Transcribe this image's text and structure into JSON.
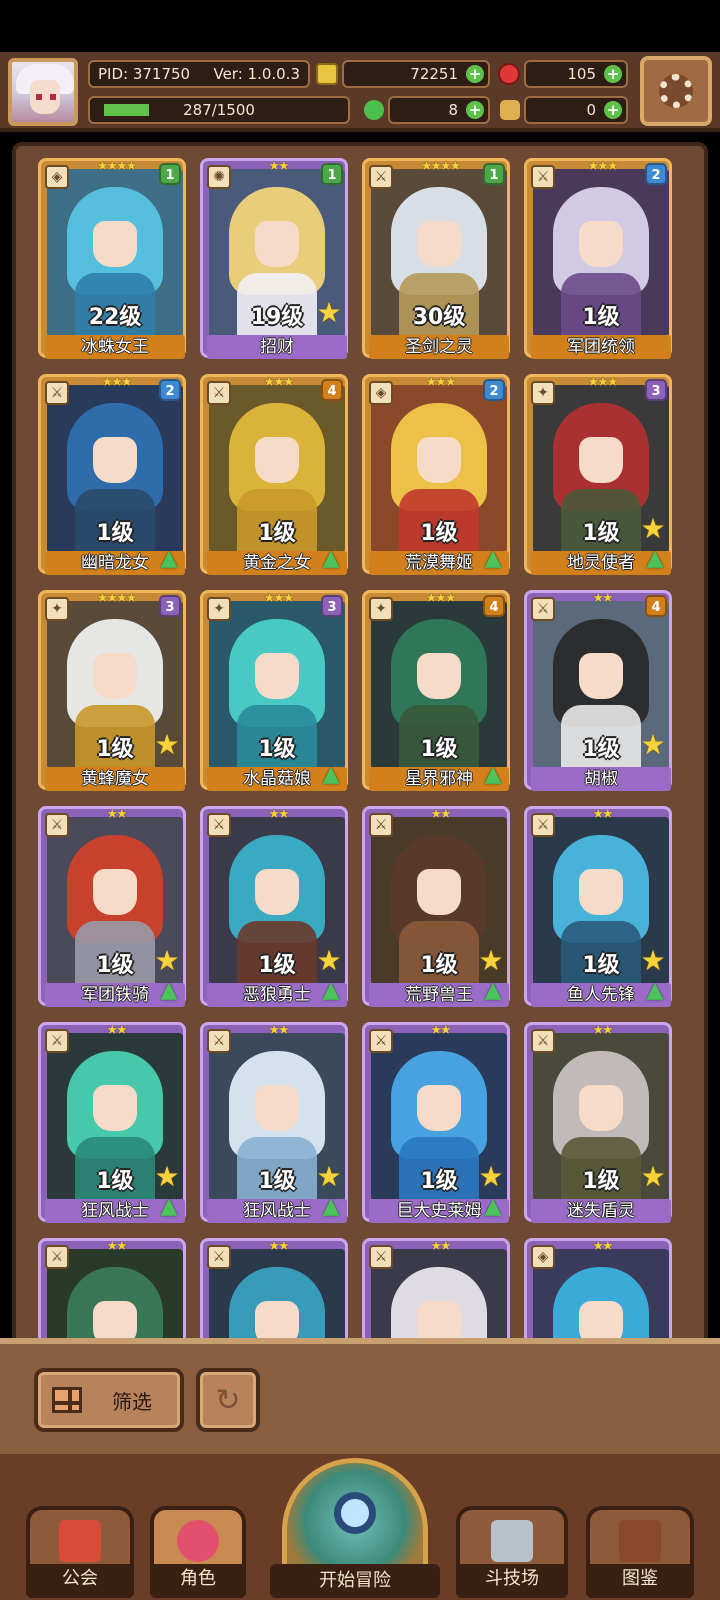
{
  "header": {
    "pid": "PID: 371750",
    "version": "Ver: 1.0.0.3",
    "gold": "72251",
    "gems": "105",
    "exp_text": "287/1500",
    "exp_progress": 0.19,
    "clover": "8",
    "hand": "0",
    "icons": [
      "avatar",
      "coin-icon",
      "ruby-icon",
      "leaf-icon",
      "clover-icon",
      "hand-icon",
      "gear-icon"
    ]
  },
  "cards": [
    {
      "name": "冰蛛女王",
      "level": "22级",
      "stars": "★★★★",
      "badge": "1",
      "frame": "orange",
      "role": "shield",
      "hair": "#59c3e3",
      "body": "#2f7ea8",
      "bg": "#3f6f86",
      "star": false,
      "up": false
    },
    {
      "name": "招财",
      "level": "19级",
      "stars": "★★",
      "badge": "1",
      "frame": "purple",
      "role": "sun",
      "hair": "#f0d47a",
      "body": "#f3f0f5",
      "bg": "#4a5a7a",
      "star": true,
      "up": false
    },
    {
      "name": "圣剑之灵",
      "level": "30级",
      "stars": "★★★★",
      "badge": "1",
      "frame": "orange",
      "role": "sword",
      "hair": "#dfe6ef",
      "body": "#b59a5a",
      "bg": "#5a4a3a",
      "star": false,
      "up": false
    },
    {
      "name": "军团统领",
      "level": "1级",
      "stars": "★★★",
      "badge": "2",
      "frame": "orange",
      "role": "sword",
      "hair": "#d8d2ea",
      "body": "#6a4a8a",
      "bg": "#4a3a5a",
      "star": false,
      "up": false
    },
    {
      "name": "幽暗龙女",
      "level": "1级",
      "stars": "★★★",
      "badge": "2",
      "frame": "orange",
      "role": "sword",
      "hair": "#2f6fb0",
      "body": "#2a4a6a",
      "bg": "#2a3a5a",
      "star": false,
      "up": true
    },
    {
      "name": "黄金之女",
      "level": "1级",
      "stars": "★★★",
      "badge": "4",
      "frame": "orange",
      "role": "sword",
      "hair": "#e0b83a",
      "body": "#c9982a",
      "bg": "#6a5a2a",
      "star": false,
      "up": true
    },
    {
      "name": "荒漠舞姬",
      "level": "1级",
      "stars": "★★★",
      "badge": "2",
      "frame": "orange",
      "role": "shield",
      "hair": "#f2c64a",
      "body": "#c0392b",
      "bg": "#8a4a2a",
      "star": false,
      "up": true
    },
    {
      "name": "地灵使者",
      "level": "1级",
      "stars": "★★★",
      "badge": "3",
      "frame": "orange",
      "role": "staff",
      "hair": "#b03030",
      "body": "#4a5a3a",
      "bg": "#3a3a3a",
      "star": true,
      "up": true
    },
    {
      "name": "黄蜂魔女",
      "level": "1级",
      "stars": "★★★★",
      "badge": "3",
      "frame": "orange",
      "role": "staff",
      "hair": "#eeeeee",
      "body": "#c9982a",
      "bg": "#5a4a3a",
      "star": true,
      "up": false
    },
    {
      "name": "水晶菇娘",
      "level": "1级",
      "stars": "★★★",
      "badge": "3",
      "frame": "orange",
      "role": "staff",
      "hair": "#4ad0c8",
      "body": "#2a8a9a",
      "bg": "#2a5a6a",
      "star": false,
      "up": true
    },
    {
      "name": "星界邪神",
      "level": "1级",
      "stars": "★★★",
      "badge": "4",
      "frame": "orange",
      "role": "staff",
      "hair": "#2f7a5a",
      "body": "#3a5a3a",
      "bg": "#2a3a3a",
      "star": false,
      "up": true
    },
    {
      "name": "胡椒",
      "level": "1级",
      "stars": "★★",
      "badge": "4",
      "frame": "purple",
      "role": "sword",
      "hair": "#2a2a2a",
      "body": "#e8e8e8",
      "bg": "#5a6a7a",
      "star": true,
      "up": false
    },
    {
      "name": "军团铁骑",
      "level": "1级",
      "stars": "★★",
      "badge": "",
      "frame": "purple",
      "role": "sword",
      "hair": "#d0402a",
      "body": "#9a9aa8",
      "bg": "#4a4a5a",
      "star": true,
      "up": true
    },
    {
      "name": "恶狼勇士",
      "level": "1级",
      "stars": "★★",
      "badge": "",
      "frame": "purple",
      "role": "sword",
      "hair": "#3ab0c8",
      "body": "#6a3a2a",
      "bg": "#3a3a4a",
      "star": true,
      "up": true
    },
    {
      "name": "荒野兽王",
      "level": "1级",
      "stars": "★★",
      "badge": "",
      "frame": "purple",
      "role": "sword",
      "hair": "#5a3a2a",
      "body": "#8a5a3a",
      "bg": "#4a3a2a",
      "star": true,
      "up": true
    },
    {
      "name": "鱼人先锋",
      "level": "1级",
      "stars": "★★",
      "badge": "",
      "frame": "purple",
      "role": "sword",
      "hair": "#4ab8e0",
      "body": "#2a5a7a",
      "bg": "#2a3a4a",
      "star": true,
      "up": true
    },
    {
      "name": "狂风战士",
      "level": "1级",
      "stars": "★★",
      "badge": "",
      "frame": "purple",
      "role": "sword",
      "hair": "#4ad0b0",
      "body": "#2a8a7a",
      "bg": "#2a3a3a",
      "star": true,
      "up": true
    },
    {
      "name": "狂风战士",
      "level": "1级",
      "stars": "★★",
      "badge": "",
      "frame": "purple",
      "role": "sword",
      "hair": "#dbeaf6",
      "body": "#8ab0d0",
      "bg": "#3a4a5a",
      "star": true,
      "up": true
    },
    {
      "name": "巨大史莱姆",
      "level": "1级",
      "stars": "★★",
      "badge": "",
      "frame": "purple",
      "role": "sword",
      "hair": "#4aa8e8",
      "body": "#2a78c0",
      "bg": "#2a3a5a",
      "star": true,
      "up": true
    },
    {
      "name": "迷失盾灵",
      "level": "1级",
      "stars": "★★",
      "badge": "",
      "frame": "purple",
      "role": "sword",
      "hair": "#c8c0c0",
      "body": "#5a5a3a",
      "bg": "#4a4a3a",
      "star": true,
      "up": false
    },
    {
      "name": "",
      "level": "",
      "stars": "★★",
      "badge": "",
      "frame": "purple",
      "role": "sword",
      "hair": "#3a7a5a",
      "body": "#3a5a3a",
      "bg": "#2a3a2a",
      "star": false,
      "up": false
    },
    {
      "name": "",
      "level": "",
      "stars": "★★",
      "badge": "",
      "frame": "purple",
      "role": "sword",
      "hair": "#3aa0c0",
      "body": "#4a6a4a",
      "bg": "#2a3a4a",
      "star": false,
      "up": false
    },
    {
      "name": "",
      "level": "",
      "stars": "★★",
      "badge": "",
      "frame": "purple",
      "role": "sword",
      "hair": "#e8e4ea",
      "body": "#6a6a7a",
      "bg": "#3a3a4a",
      "star": false,
      "up": false
    },
    {
      "name": "",
      "level": "",
      "stars": "★★",
      "badge": "",
      "frame": "purple",
      "role": "shield",
      "hair": "#3ab0e0",
      "body": "#d04040",
      "bg": "#3a3a5a",
      "star": false,
      "up": false
    }
  ],
  "controls": {
    "filter_label": "筛选",
    "reset_icon": "refresh-icon"
  },
  "nav": {
    "guild": "公会",
    "character": "角色",
    "adventure": "开始冒险",
    "arena": "斗技场",
    "codex": "图鉴"
  },
  "colors": {
    "badge_green": "#4da84a",
    "badge_blue": "#3f8ad0",
    "badge_orange": "#d2801c",
    "badge_purple": "#8c62b8"
  }
}
